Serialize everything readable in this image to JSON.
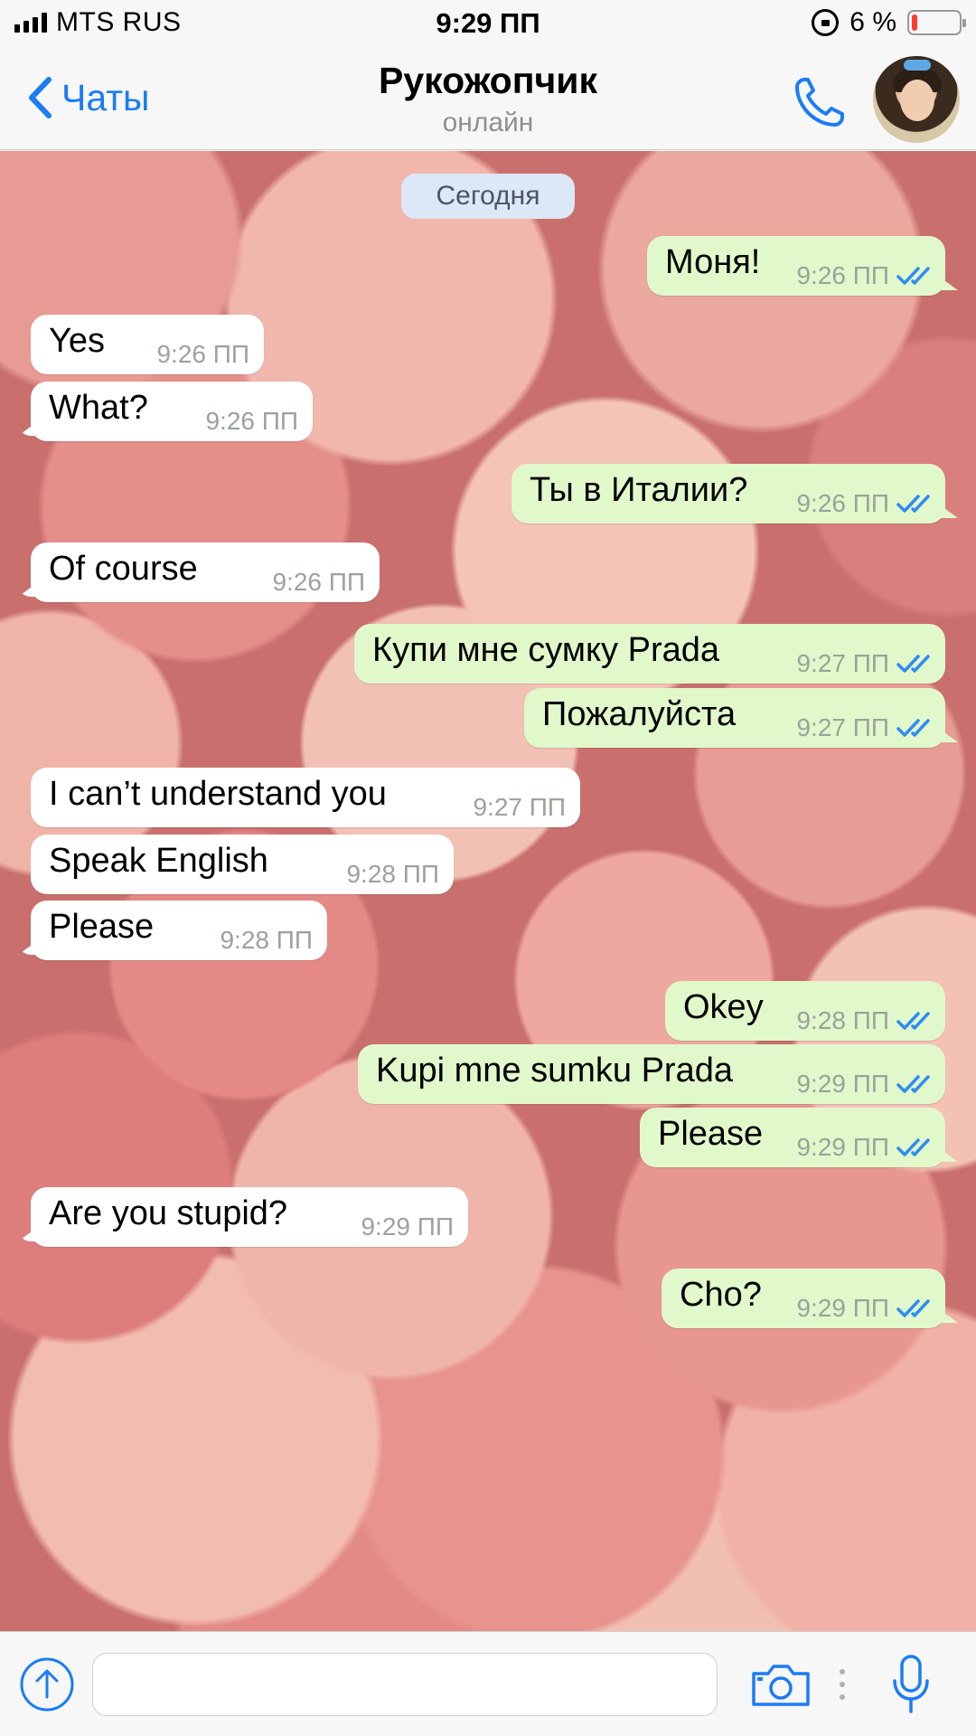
{
  "status_bar": {
    "carrier": "MTS RUS",
    "time": "9:29 ПП",
    "battery_percent": "6 %",
    "battery_level": 0.06
  },
  "header": {
    "back_label": "Чаты",
    "contact_name": "Рукожопчик",
    "contact_status": "онлайн"
  },
  "chat": {
    "date_label": "Сегодня",
    "messages": [
      {
        "dir": "out",
        "text": "Моня!",
        "time": "9:26 ПП",
        "read": true
      },
      {
        "dir": "in",
        "text": "Yes",
        "time": "9:26 ПП"
      },
      {
        "dir": "in",
        "text": "What?",
        "time": "9:26 ПП"
      },
      {
        "dir": "out",
        "text": "Ты в Италии?",
        "time": "9:26 ПП",
        "read": true
      },
      {
        "dir": "in",
        "text": "Of course",
        "time": "9:26 ПП"
      },
      {
        "dir": "out",
        "text": "Купи мне сумку Prada",
        "time": "9:27 ПП",
        "read": true
      },
      {
        "dir": "out",
        "text": "Пожалуйста",
        "time": "9:27 ПП",
        "read": true
      },
      {
        "dir": "in",
        "text": "I can’t understand you",
        "time": "9:27 ПП"
      },
      {
        "dir": "in",
        "text": "Speak English",
        "time": "9:28 ПП"
      },
      {
        "dir": "in",
        "text": "Please",
        "time": "9:28 ПП"
      },
      {
        "dir": "out",
        "text": "Okey",
        "time": "9:28 ПП",
        "read": true
      },
      {
        "dir": "out",
        "text": "Kupi mne sumku Prada",
        "time": "9:29 ПП",
        "read": true
      },
      {
        "dir": "out",
        "text": "Please",
        "time": "9:29 ПП",
        "read": true
      },
      {
        "dir": "in",
        "text": "Are you stupid?",
        "time": "9:29 ПП"
      },
      {
        "dir": "out",
        "text": "Cho?",
        "time": "9:29 ПП",
        "read": true
      }
    ]
  },
  "input": {
    "value": "",
    "placeholder": ""
  },
  "icons": {
    "back": "chevron-left-icon",
    "call": "phone-icon",
    "attach": "upload-arrow-icon",
    "camera": "camera-icon",
    "more": "more-dots-icon",
    "mic": "microphone-icon",
    "read": "double-check-icon"
  },
  "colors": {
    "accent": "#1b7cf6",
    "outgoing_bubble": "#e1f8cb",
    "incoming_bubble": "#ffffff",
    "read_check": "#2f8cf0",
    "date_chip": "#dce7f7",
    "battery_low": "#ff3b30"
  }
}
